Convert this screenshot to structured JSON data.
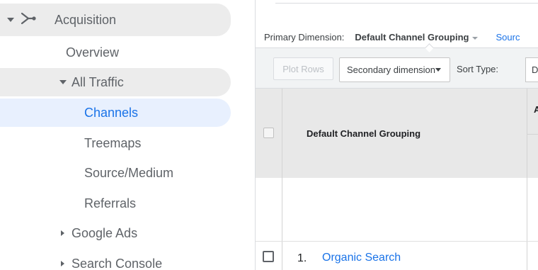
{
  "sidebar": {
    "acquisition": {
      "label": "Acquisition",
      "icon": "acquisition-icon"
    },
    "overview": {
      "label": "Overview"
    },
    "all_traffic": {
      "label": "All Traffic"
    },
    "channels": {
      "label": "Channels"
    },
    "treemaps": {
      "label": "Treemaps"
    },
    "source_medium": {
      "label": "Source/Medium"
    },
    "referrals": {
      "label": "Referrals"
    },
    "google_ads": {
      "label": "Google Ads"
    },
    "search_console": {
      "label": "Search Console"
    }
  },
  "report": {
    "primary_dimension_label": "Primary Dimension:",
    "primary_dimension_value": "Default Channel Grouping",
    "source_link": "Sourc",
    "toolbar": {
      "plot_rows": "Plot Rows",
      "secondary_dimension": "Secondary dimension",
      "sort_type_label": "Sort Type:",
      "sort_type_value": "D"
    },
    "table": {
      "column_header": "Default Channel Grouping",
      "next_header_partial": "A",
      "rows": [
        {
          "index": "1.",
          "channel": "Organic Search"
        }
      ]
    }
  },
  "colors": {
    "accent": "#1a73e8",
    "active_bg": "#e8f0fe",
    "highlight_bg": "#ececec",
    "header_bg": "#e8e8e8"
  }
}
